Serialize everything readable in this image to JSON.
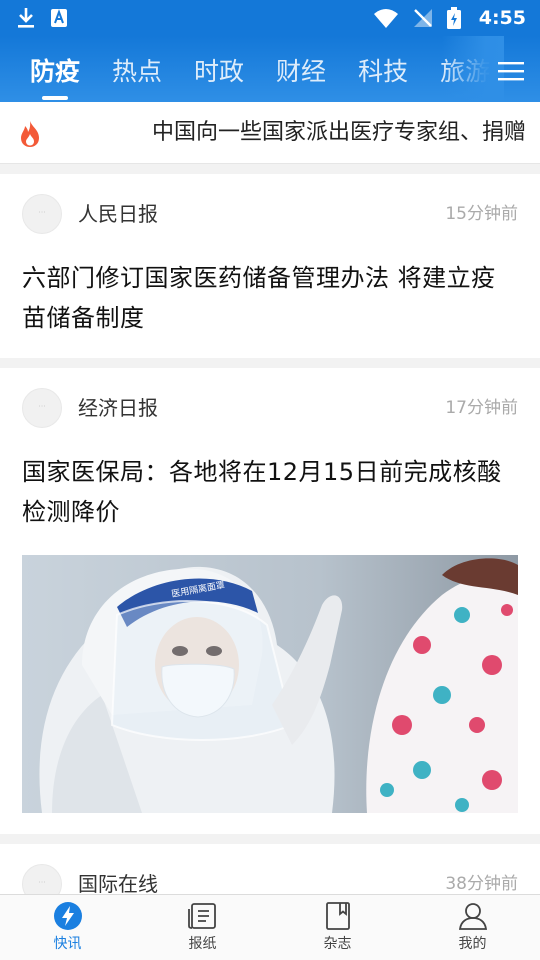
{
  "status_bar": {
    "time": "4:55",
    "icons": [
      "download-icon",
      "app-notification-icon",
      "wifi-icon",
      "no-signal-icon",
      "battery-charging-icon"
    ]
  },
  "tabs": [
    {
      "label": "防疫",
      "active": true
    },
    {
      "label": "热点",
      "active": false
    },
    {
      "label": "时政",
      "active": false
    },
    {
      "label": "财经",
      "active": false
    },
    {
      "label": "科技",
      "active": false
    },
    {
      "label": "旅游",
      "active": false
    }
  ],
  "ticker": {
    "icon": "fire-icon",
    "text": "中国向一些国家派出医疗专家组、捐赠"
  },
  "feed": [
    {
      "source": "人民日报",
      "time": "15分钟前",
      "title": "六部门修订国家医药储备管理办法 将建立疫苗储备制度"
    },
    {
      "source": "经济日报",
      "time": "17分钟前",
      "title": "国家医保局：各地将在12月15日前完成核酸检测降价",
      "image": "medical-worker-photo"
    },
    {
      "source": "国际在线",
      "time": "38分钟前"
    }
  ],
  "bottom_nav": [
    {
      "label": "快讯",
      "icon": "lightning-icon",
      "active": true
    },
    {
      "label": "报纸",
      "icon": "newspaper-icon",
      "active": false
    },
    {
      "label": "杂志",
      "icon": "magazine-icon",
      "active": false
    },
    {
      "label": "我的",
      "icon": "profile-icon",
      "active": false
    }
  ],
  "colors": {
    "brand": "#1478d8",
    "active_nav": "#1a7fe0"
  }
}
